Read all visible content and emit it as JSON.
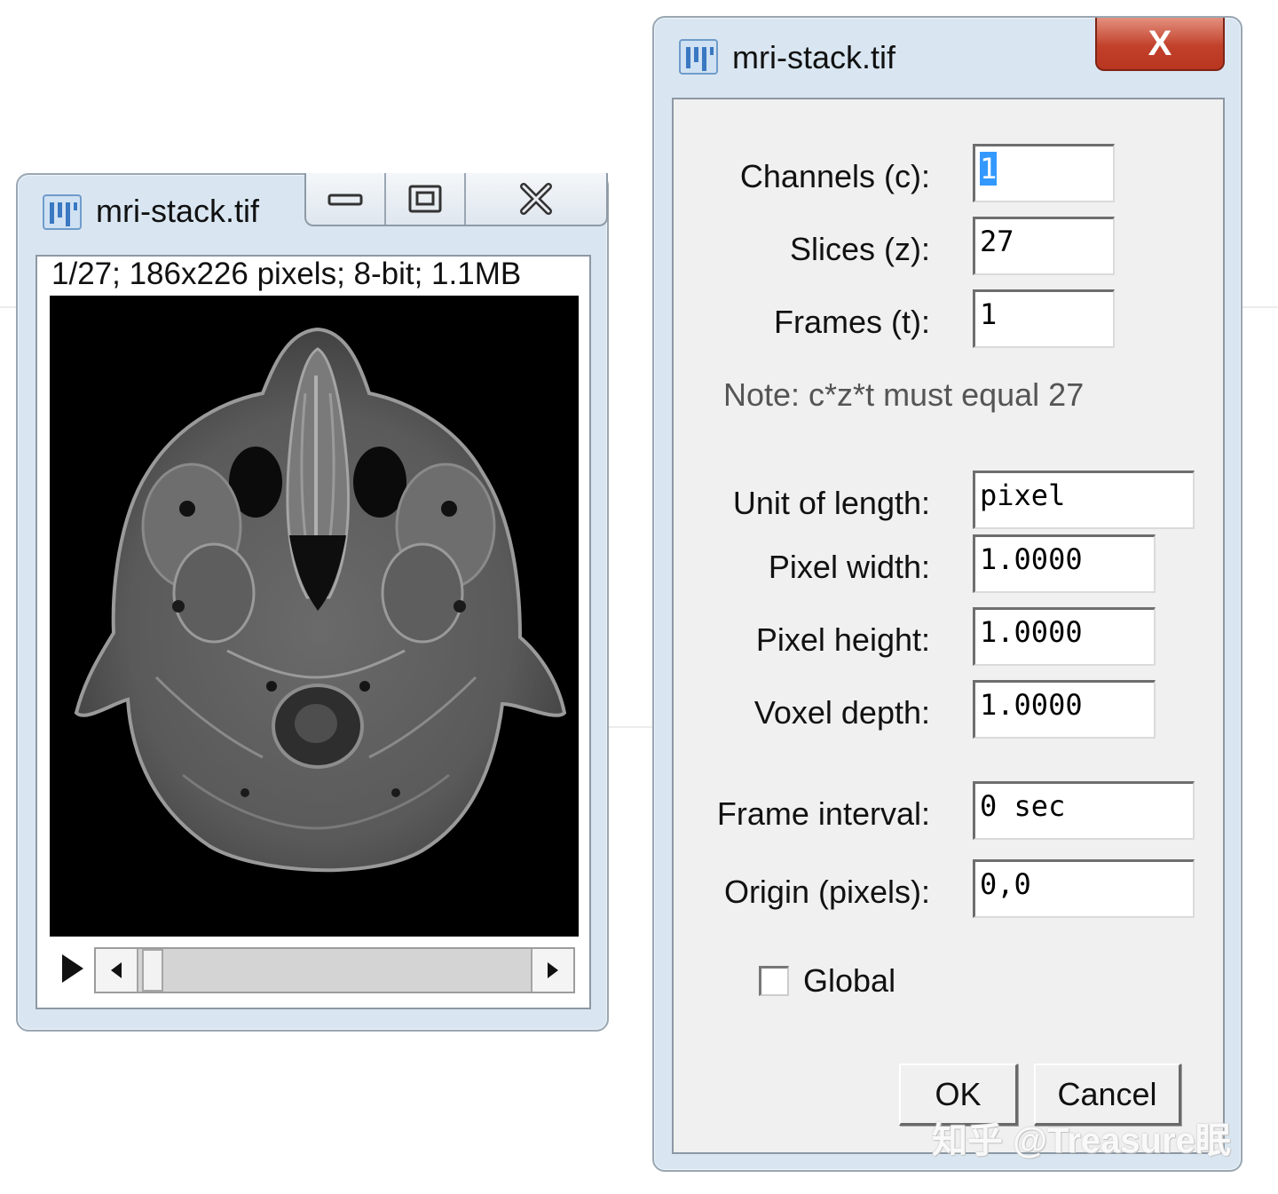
{
  "image_window": {
    "title": "mri-stack.tif",
    "controls": {
      "minimize": "minimize-icon",
      "maximize": "maximize-icon",
      "close": "close-icon"
    },
    "status": "1/27; 186x226 pixels; 8-bit; 1.1MB",
    "slider": {
      "current_slice": 1,
      "total_slices": 27
    }
  },
  "dialog": {
    "title": "mri-stack.tif",
    "close_label": "X",
    "fields": {
      "channels": {
        "label": "Channels (c):",
        "value": "1"
      },
      "slices": {
        "label": "Slices (z):",
        "value": "27"
      },
      "frames": {
        "label": "Frames (t):",
        "value": "1"
      },
      "unit": {
        "label": "Unit of length:",
        "value": "pixel"
      },
      "pixel_width": {
        "label": "Pixel width:",
        "value": "1.0000"
      },
      "pixel_height": {
        "label": "Pixel height:",
        "value": "1.0000"
      },
      "voxel_depth": {
        "label": "Voxel depth:",
        "value": "1.0000"
      },
      "frame_interval": {
        "label": "Frame interval:",
        "value": "0 sec"
      },
      "origin": {
        "label": "Origin (pixels):",
        "value": "0,0"
      }
    },
    "note": "Note: c*z*t must equal 27",
    "global": {
      "label": "Global",
      "checked": false
    },
    "ok_label": "OK",
    "cancel_label": "Cancel"
  },
  "watermark": "知乎 @Treasure眠"
}
